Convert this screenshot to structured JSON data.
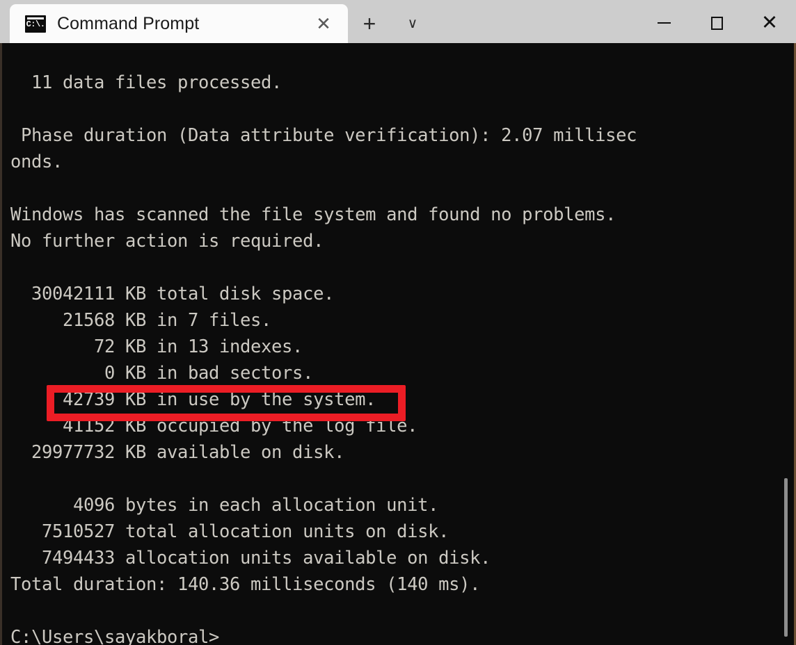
{
  "window": {
    "title": "Command Prompt",
    "tab": {
      "label": "Command Prompt",
      "icon": "cmd-icon",
      "icon_glyph": "C:\\.",
      "close_label": "✕"
    },
    "toolbar": {
      "new_tab_label": "+",
      "dropdown_label": "∨"
    },
    "controls": {
      "minimize_label": "—",
      "maximize_label": "□",
      "close_label": "✕"
    }
  },
  "terminal": {
    "background_color": "#0c0c0c",
    "foreground_color": "#ccc9c2",
    "lines": [
      "",
      "  11 data files processed.",
      "",
      " Phase duration (Data attribute verification): 2.07 millisec",
      "onds.",
      "",
      "Windows has scanned the file system and found no problems.",
      "No further action is required.",
      "",
      "  30042111 KB total disk space.",
      "     21568 KB in 7 files.",
      "        72 KB in 13 indexes.",
      "         0 KB in bad sectors.",
      "     42739 KB in use by the system.",
      "     41152 KB occupied by the log file.",
      "  29977732 KB available on disk.",
      "",
      "      4096 bytes in each allocation unit.",
      "   7510527 total allocation units on disk.",
      "   7494433 allocation units available on disk.",
      "Total duration: 140.36 milliseconds (140 ms).",
      "",
      "C:\\Users\\sayakboral>"
    ],
    "prompt": "C:\\Users\\sayakboral>"
  },
  "annotation": {
    "type": "highlight-rectangle",
    "color": "#ec1d25",
    "target_text": "         0 KB in bad sectors."
  }
}
